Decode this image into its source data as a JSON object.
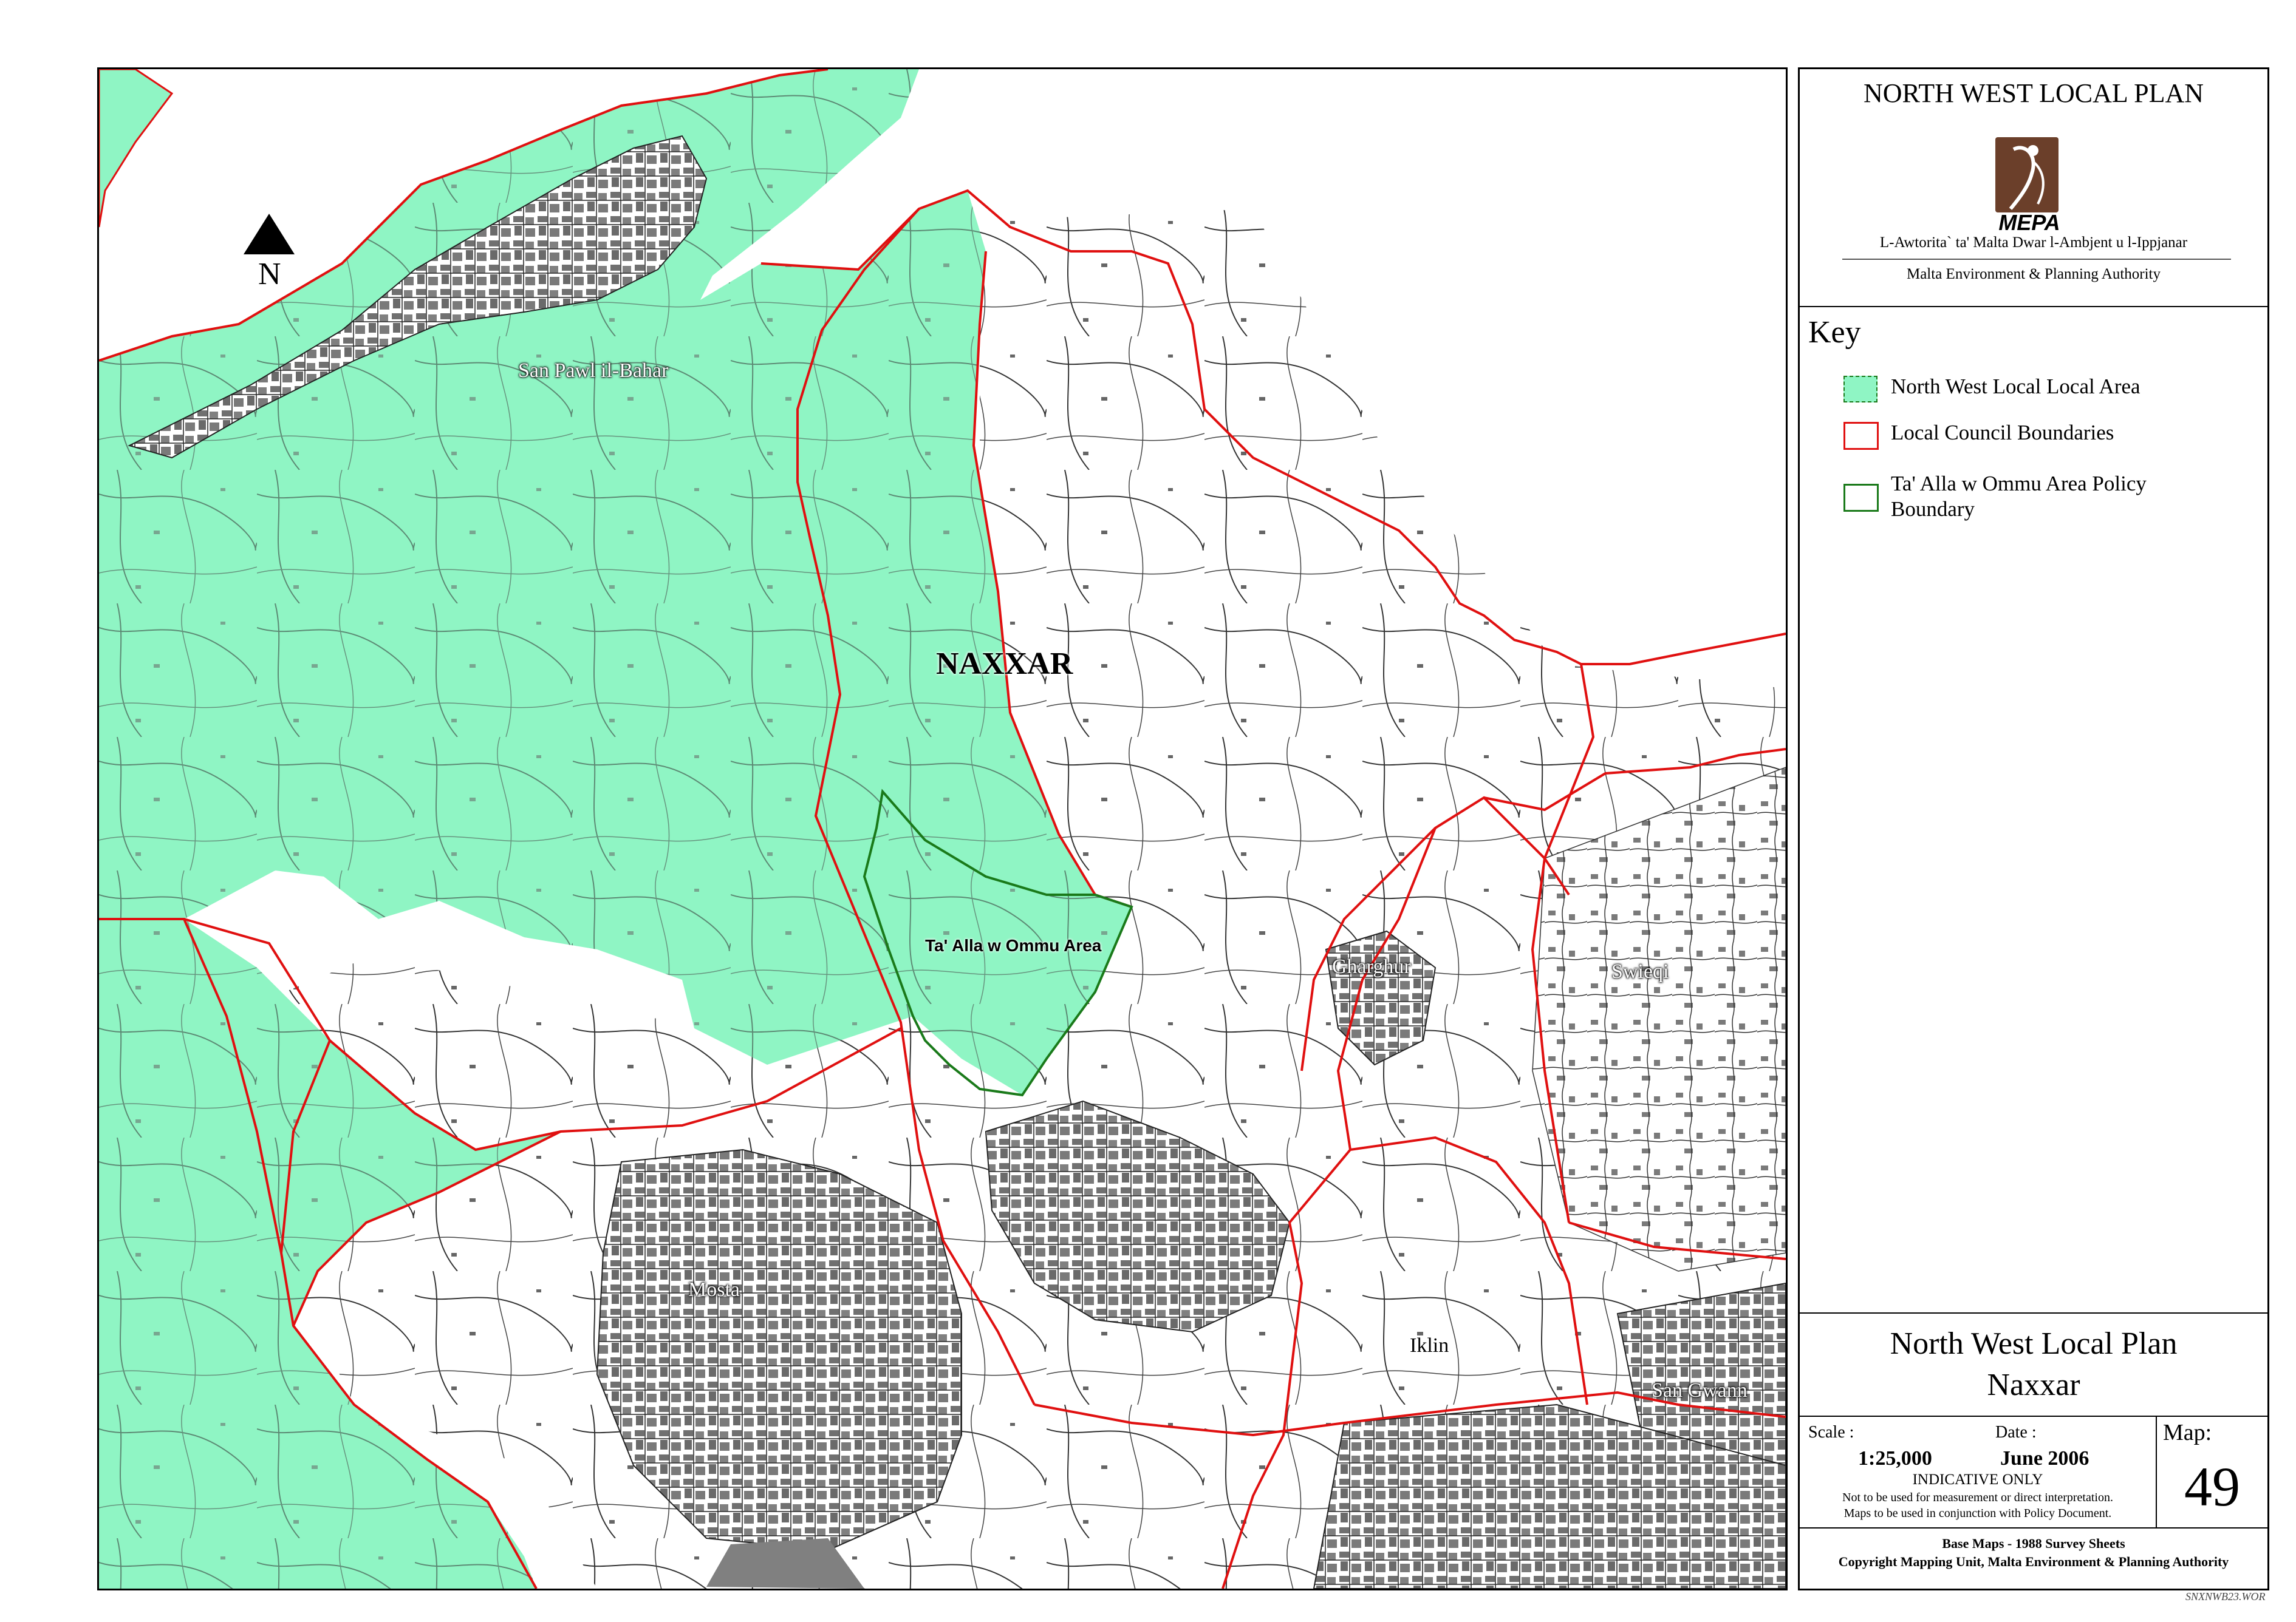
{
  "map": {
    "north_label": "N",
    "place_labels": {
      "san_pawl": "San Pawl il-Bahar",
      "naxxar": "NAXXAR",
      "ta_alla": "Ta' Alla w Ommu Area",
      "gharghur": "Gharghur",
      "swieqi": "Swieqi",
      "mosta": "Mosta",
      "iklin": "Iklin",
      "san_gwann": "San Gwann"
    },
    "colors": {
      "local_area_fill": "#8ff5c4",
      "council_boundary": "#e01010",
      "policy_boundary": "#1a7a1a",
      "buildings": "#707070",
      "roads": "#000000"
    }
  },
  "panel": {
    "header_title": "NORTH WEST LOCAL PLAN",
    "logo_text": "MEPA",
    "authority_maltese": "L-Awtorita` ta' Malta Dwar l-Ambjent u l-Ippjanar",
    "authority_english": "Malta Environment & Planning Authority",
    "key_title": "Key",
    "key_items": [
      {
        "label": "North West Local Local Area",
        "swatch": "local-area"
      },
      {
        "label": "Local Council Boundaries",
        "swatch": "council"
      },
      {
        "label": "Ta' Alla w Ommu Area Policy Boundary",
        "swatch": "policy"
      }
    ],
    "plan_title_line1": "North West Local Plan",
    "plan_title_line2": "Naxxar",
    "scale_label": "Scale :",
    "scale_value": "1:25,000",
    "date_label": "Date :",
    "date_value": "June 2006",
    "map_label": "Map:",
    "map_number": "49",
    "indicative": "INDICATIVE ONLY",
    "disclaimer_line1": "Not to be used for measurement or direct interpretation.",
    "disclaimer_line2": "Maps to be used in conjunction with Policy Document.",
    "base_maps": "Base Maps - 1988 Survey Sheets",
    "copyright": "Copyright Mapping Unit, Malta Environment & Planning Authority",
    "file_code": "SNXNWB23.WOR"
  }
}
